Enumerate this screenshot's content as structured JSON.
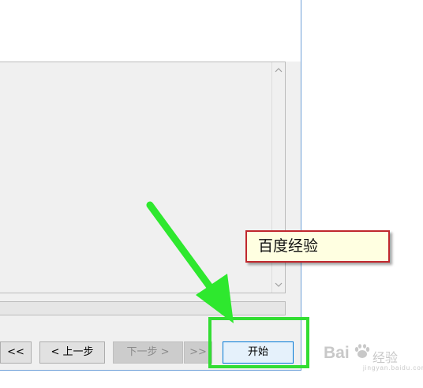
{
  "dialog": {
    "progress_fraction": 0
  },
  "buttons": {
    "first_label": "<<",
    "prev_label": "< 上一步",
    "next_label": "下一步 >",
    "last_label": ">>",
    "start_label": "开始"
  },
  "annotation": {
    "note_text": "百度经验",
    "arrow_color": "#2ee82e",
    "highlight_color": "#33dd33",
    "note_border_color": "#c0282d",
    "note_bg_color": "#ffffe1"
  },
  "watermark": {
    "logo": "Bai",
    "text": "经验",
    "sub": "jingyan.baidu.com"
  },
  "icons": {
    "scroll_up": "chevron-up-icon",
    "scroll_down": "chevron-down-icon",
    "watermark_paw": "paw-icon"
  }
}
